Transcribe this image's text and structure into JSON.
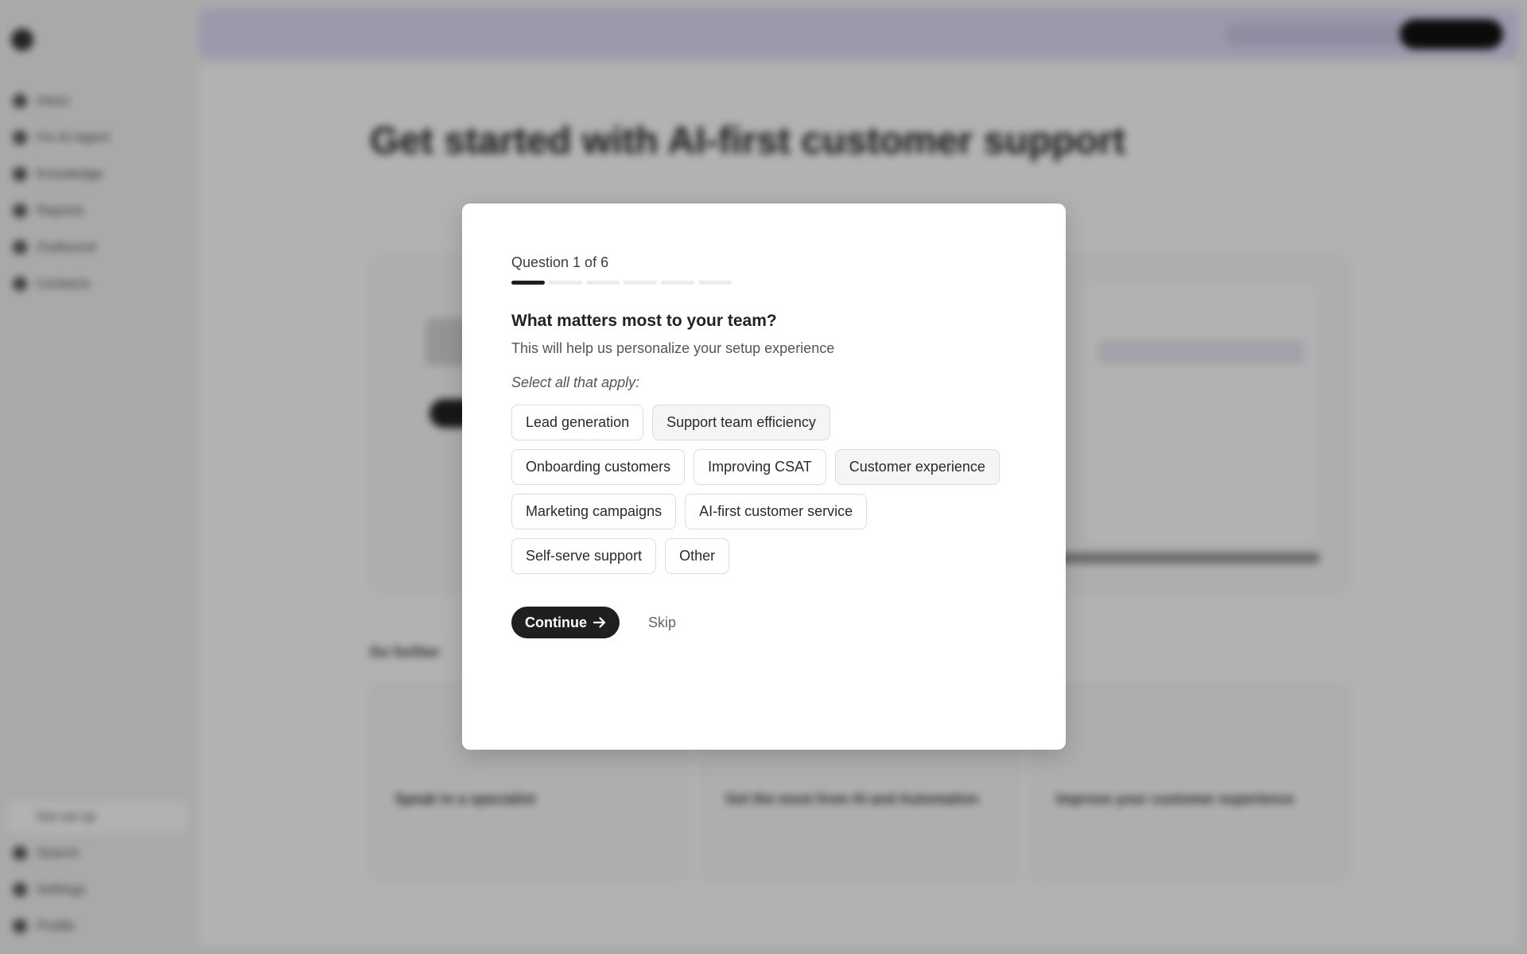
{
  "modal": {
    "question_counter": "Question 1 of 6",
    "progress": {
      "current": 1,
      "total": 6
    },
    "title": "What matters most to your team?",
    "subtitle": "This will help us personalize your setup experience",
    "hint": "Select all that apply:",
    "options": [
      "Lead generation",
      "Support team efficiency",
      "Onboarding customers",
      "Improving CSAT",
      "Customer experience",
      "Marketing campaigns",
      "AI-first customer service",
      "Self-serve support",
      "Other"
    ],
    "continue_label": "Continue",
    "continue_icon": "arrow-right-icon",
    "skip_label": "Skip"
  },
  "background": {
    "headline": "Get started with AI-first customer support",
    "nav_items": [
      "Inbox",
      "Fin AI Agent",
      "Knowledge",
      "Reports",
      "Outbound",
      "Contacts"
    ],
    "bottom_nav": [
      "Get set up",
      "Search",
      "Settings",
      "Profile"
    ],
    "cards": [
      {
        "title": "Speak to a specialist"
      },
      {
        "title": "Get the most from AI and Automation"
      },
      {
        "title": "Improve your customer experience"
      }
    ],
    "section_title": "Go further"
  },
  "colors": {
    "primary_button": "#1f1f1f",
    "banner": "#e0dcf7",
    "overlay": "rgba(0,0,0,0.30)"
  }
}
